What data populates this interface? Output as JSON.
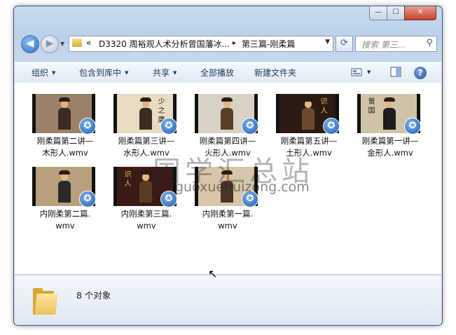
{
  "window_controls": {
    "minimize": "—",
    "maximize": "☐",
    "close": "✕"
  },
  "nav": {
    "back": "◀",
    "forward": "▶",
    "dropdown": "▼"
  },
  "address": {
    "chevron": "«",
    "segments": [
      "D3320 周裕观人术分析曾国藩冰...",
      "第三篇-刚柔篇"
    ],
    "separator": "▸",
    "dropdown": "▼"
  },
  "refresh": "⟳",
  "search": {
    "placeholder": "搜索 第三...",
    "icon": "⚲"
  },
  "toolbar": {
    "organize": "组织",
    "include": "包含到库中",
    "share": "共享",
    "play_all": "全部播放",
    "new_folder": "新建文件夹",
    "caret": "▼",
    "view_caret": "▼",
    "help": "?"
  },
  "files": [
    {
      "line1": "刚柔篇第二讲—",
      "line2": "木形人.wmv",
      "bg": "#9a8168",
      "robe": "#3a2a22",
      "caption": ""
    },
    {
      "line1": "刚柔篇第三讲—",
      "line2": "水形人.wmv",
      "bg": "#e8dcc2",
      "robe": "#3b2c22",
      "caption": "少\n之\n庸"
    },
    {
      "line1": "刚柔篇第四讲—",
      "line2": "火形人.wmv",
      "bg": "#d9d2c4",
      "robe": "#5a3f2c",
      "caption": ""
    },
    {
      "line1": "刚柔篇第五讲—",
      "line2": "土形人.wmv",
      "bg": "#2a1a12",
      "robe": "#6b4a2e",
      "caption": "识\n人"
    },
    {
      "line1": "刚柔篇第一讲—",
      "line2": "金形人.wmv",
      "bg": "#cfc3a8",
      "robe": "#1d1d1d",
      "caption": "曾\n国"
    },
    {
      "line1": "内刚柔第二篇.",
      "line2": "wmv",
      "bg": "#b9a07c",
      "robe": "#2a2a2a",
      "caption": ""
    },
    {
      "line1": "内刚柔第三篇.",
      "line2": "wmv",
      "bg": "#3a1a14",
      "robe": "#5c3b26",
      "caption": "识\n人"
    },
    {
      "line1": "内刚柔第一篇.",
      "line2": "wmv",
      "bg": "#d6c7a8",
      "robe": "#4a3526",
      "caption": ""
    }
  ],
  "badge_glyph": "✪",
  "status": {
    "count": "8 个对象"
  },
  "watermark": {
    "main": "国学汇总站",
    "url": "guoxuehuizong.com"
  },
  "cursor": "↖",
  "colors": {
    "titlebar": "#c9dbef",
    "toolbar_text": "#1e395b",
    "close": "#c7412b"
  }
}
